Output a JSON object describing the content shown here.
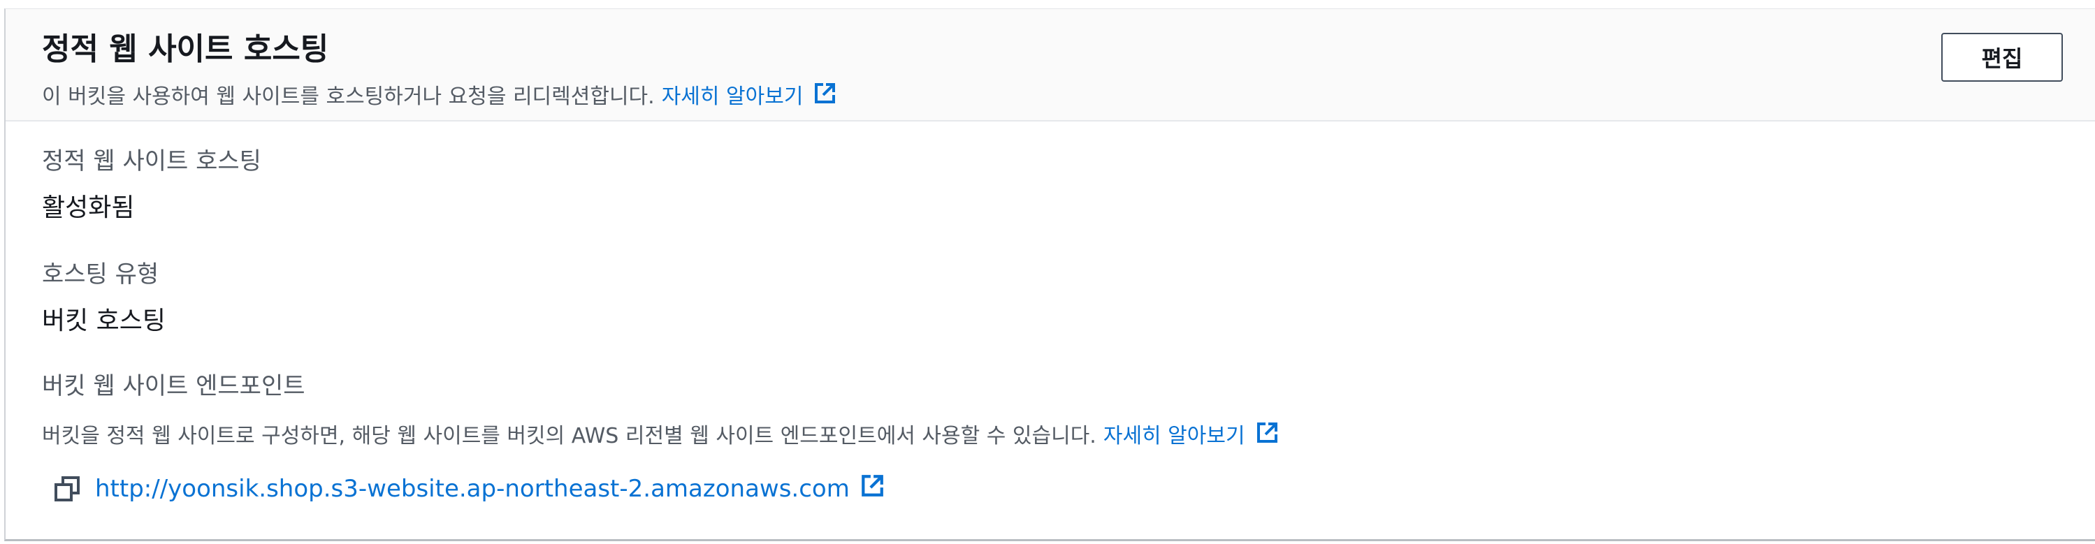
{
  "header": {
    "title": "정적 웹 사이트 호스팅",
    "description": "이 버킷을 사용하여 웹 사이트를 호스팅하거나 요청을 리디렉션합니다.",
    "learn_more": "자세히 알아보기",
    "learn_more_icon": "external-link-icon",
    "edit_label": "편집"
  },
  "fields": {
    "hosting": {
      "label": "정적 웹 사이트 호스팅",
      "value": "활성화됨"
    },
    "hosting_type": {
      "label": "호스팅 유형",
      "value": "버킷 호스팅"
    },
    "endpoint": {
      "label": "버킷 웹 사이트 엔드포인트",
      "description": "버킷을 정적 웹 사이트로 구성하면, 해당 웹 사이트를 버킷의 AWS 리전별 웹 사이트 엔드포인트에서 사용할 수 있습니다.",
      "learn_more": "자세히 알아보기",
      "url": "http://yoonsik.shop.s3-website.ap-northeast-2.amazonaws.com",
      "copy_icon": "copy-icon"
    }
  },
  "colors": {
    "link": "#0972d3",
    "title": "#16191f",
    "secondary_text": "#545b64",
    "header_bg": "#fafafa"
  }
}
